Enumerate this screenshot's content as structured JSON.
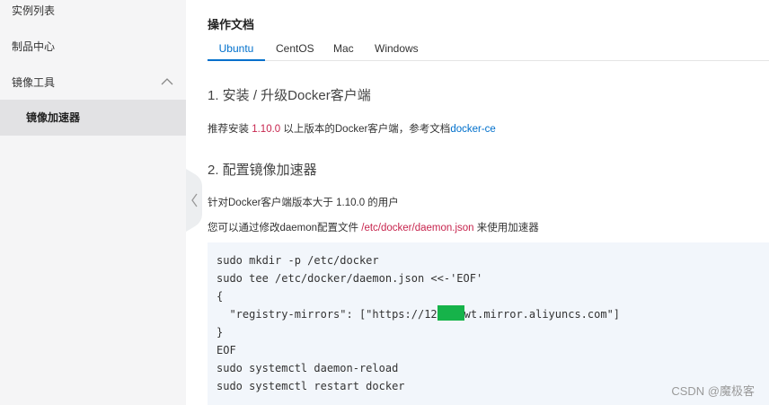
{
  "sidebar": {
    "items": [
      {
        "label": "实例列表"
      },
      {
        "label": "制品中心"
      },
      {
        "label": "镜像工具"
      },
      {
        "label": "镜像加速器"
      }
    ]
  },
  "main": {
    "title": "操作文档",
    "tabs": [
      {
        "label": "Ubuntu",
        "active": true
      },
      {
        "label": "CentOS"
      },
      {
        "label": "Mac"
      },
      {
        "label": "Windows"
      }
    ],
    "section1": {
      "heading": "1. 安装 / 升级Docker客户端",
      "text_before": "推荐安装 ",
      "version": "1.10.0",
      "text_after": " 以上版本的Docker客户端，参考文档",
      "link": "docker-ce"
    },
    "section2": {
      "heading": "2. 配置镜像加速器",
      "line1": "针对Docker客户端版本大于 1.10.0 的用户",
      "line2_before": "您可以通过修改daemon配置文件 ",
      "line2_path": "/etc/docker/daemon.json",
      "line2_after": " 来使用加速器"
    },
    "code": {
      "l1": "sudo mkdir -p /etc/docker",
      "l2": "sudo tee /etc/docker/daemon.json <<-'EOF'",
      "l3": "{",
      "l4_before": "  \"registry-mirrors\": [\"https://12",
      "l4_after": "wt.mirror.aliyuncs.com\"]",
      "l5": "}",
      "l6": "EOF",
      "l7": "sudo systemctl daemon-reload",
      "l8": "sudo systemctl restart docker"
    }
  },
  "watermark": "CSDN @魔极客",
  "colors": {
    "accent": "#0070cc",
    "path_red": "#c7254e",
    "redaction": "#16b34a"
  }
}
